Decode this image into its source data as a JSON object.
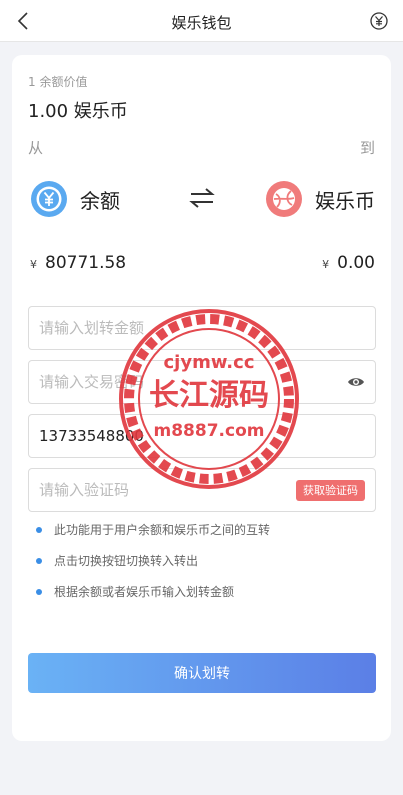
{
  "nav": {
    "title": "娱乐钱包",
    "back_icon": "chevron-left-icon",
    "right_icon": "yen-circle-icon"
  },
  "rate": {
    "base": "1 余额价值",
    "result": "1.00 娱乐币"
  },
  "direction": {
    "from_label": "从",
    "to_label": "到"
  },
  "from_account": {
    "name": "余额",
    "icon": "yen-coin-icon",
    "currency_symbol": "¥",
    "amount": "80771.58"
  },
  "to_account": {
    "name": "娱乐币",
    "icon": "ball-icon",
    "currency_symbol": "¥",
    "amount": "0.00"
  },
  "form": {
    "amount_placeholder": "请输入划转金额",
    "password_placeholder": "请输入交易密码",
    "phone_value": "13733548800",
    "code_placeholder": "请输入验证码",
    "get_code_label": "获取验证码"
  },
  "tips": [
    "此功能用于用户余额和娱乐币之间的互转",
    "点击切换按钮切换转入转出",
    "根据余额或者娱乐币输入划转金额"
  ],
  "submit_label": "确认划转",
  "watermark": {
    "line1": "cjymw.cc",
    "line2": "长江源码",
    "line3": "m8887.com"
  },
  "colors": {
    "accent_blue": "#3a8ee6",
    "balance_icon": "#5aa9f0",
    "coin_icon": "#f07b7b",
    "code_button": "#ef6f6f",
    "watermark": "#e0363c"
  }
}
